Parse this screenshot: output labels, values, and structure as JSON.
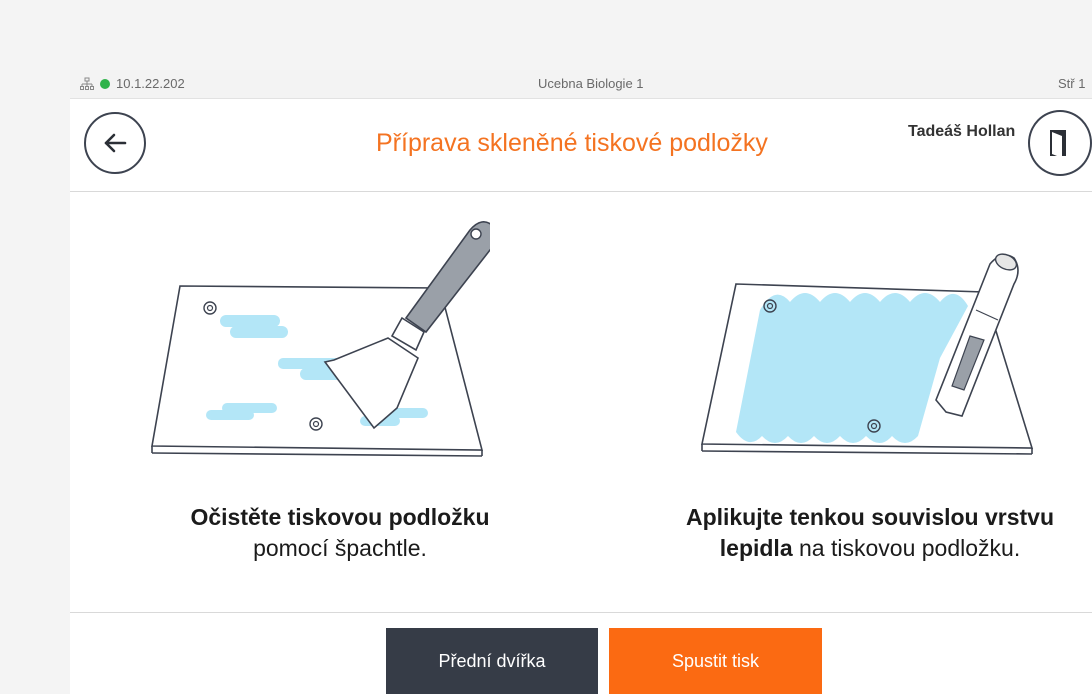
{
  "statusbar": {
    "ip": "10.1.22.202",
    "room": "Ucebna Biologie 1",
    "day": "Stř 1",
    "online_color": "#2fb34a"
  },
  "header": {
    "back_icon": "arrow-left-icon",
    "title": "Příprava skleněné tiskové podložky",
    "user": "Tadeáš Hollan",
    "account_icon": "logout-icon"
  },
  "steps": [
    {
      "illustration": "spatula-cleaning-glass-plate",
      "bold": "Očistěte tiskovou podložku",
      "normal": "pomocí špachtle."
    },
    {
      "illustration": "glue-stick-on-glass-plate",
      "bold_line1": "Aplikujte tenkou souvislou vrstvu",
      "bold_line2": "lepidla",
      "normal_line2": " na tiskovou podložku."
    }
  ],
  "buttons": {
    "front_door": "Přední dvířka",
    "start_print": "Spustit tisk"
  },
  "colors": {
    "accent": "#f47321",
    "primary_button": "#fb6a12",
    "dark_button": "#363c47",
    "glue": "#b3e6f7"
  }
}
